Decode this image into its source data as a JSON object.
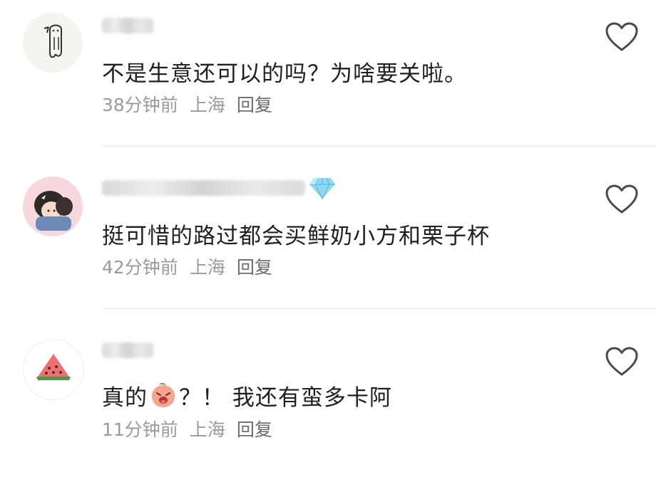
{
  "comments": [
    {
      "text": "不是生意还可以的吗？为啥要关啦。",
      "time": "38分钟前",
      "location": "上海",
      "reply": "回复"
    },
    {
      "text": "挺可惜的路过都会买鲜奶小方和栗子杯",
      "time": "42分钟前",
      "location": "上海",
      "reply": "回复"
    },
    {
      "text_before": "真的",
      "text_after": "？！ 我还有蛮多卡阿",
      "time": "11分钟前",
      "location": "上海",
      "reply": "回复"
    }
  ],
  "colors": {
    "text": "#1f1f1f",
    "meta": "#9a9a9a",
    "reply": "#6b6b6b",
    "divider": "#e6e6e6",
    "heart_outline": "#4a4a4a",
    "diamond": "#8fd8f2"
  },
  "icons": [
    "heart-outline-icon",
    "diamond-badge-icon",
    "watermelon-icon",
    "peach-emoji-icon"
  ]
}
